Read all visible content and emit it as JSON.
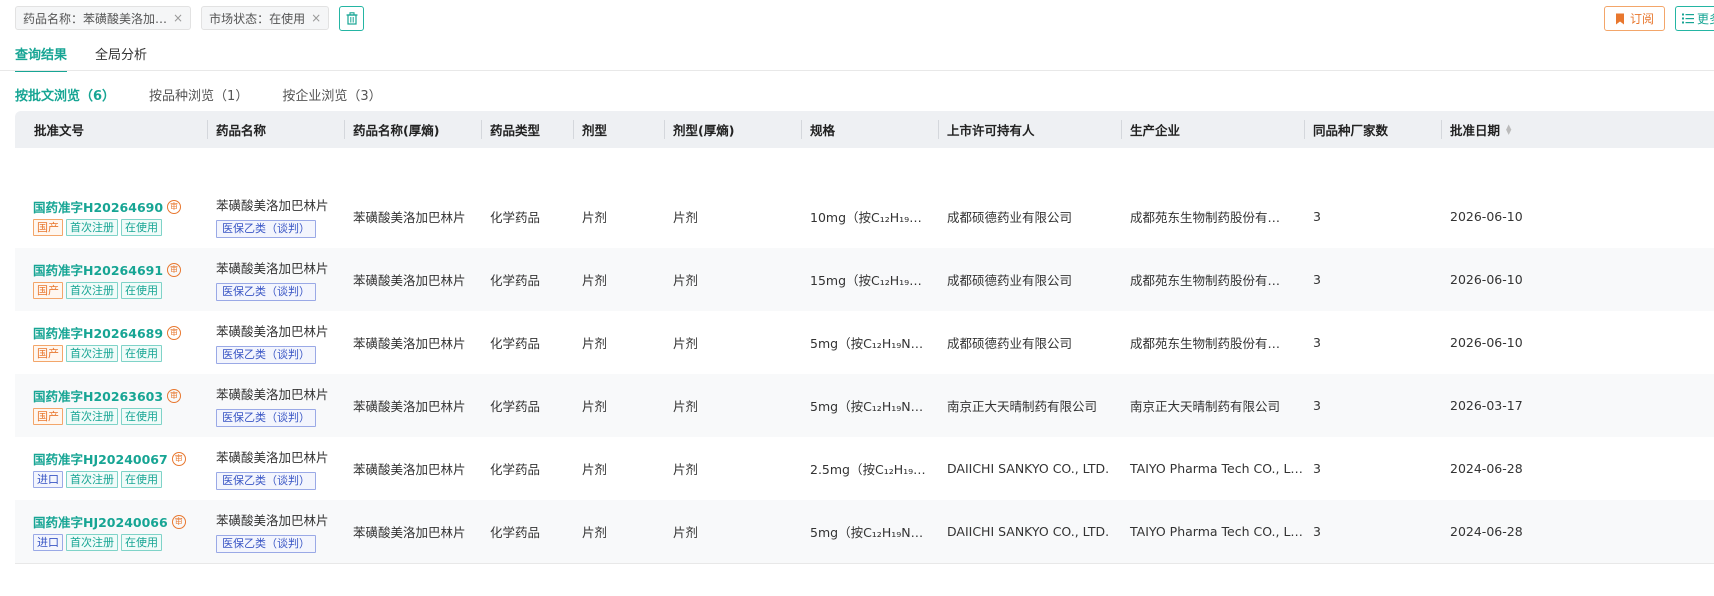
{
  "filters": {
    "chips": [
      {
        "label": "药品名称：苯磺酸美洛加…"
      },
      {
        "label": "市场状态：在使用"
      }
    ],
    "close_glyph": "×"
  },
  "actions": {
    "subscribe_label": "订阅",
    "more_label": "更多"
  },
  "tabs": [
    {
      "label": "查询结果",
      "active": true
    },
    {
      "label": "全局分析",
      "active": false
    }
  ],
  "subtabs": [
    {
      "label": "按批文浏览（6）",
      "active": true
    },
    {
      "label": "按品种浏览（1）",
      "active": false
    },
    {
      "label": "按企业浏览（3）",
      "active": false
    }
  ],
  "table": {
    "headers": [
      "批准文号",
      "药品名称",
      "药品名称(厚熵)",
      "药品类型",
      "剂型",
      "剂型(厚熵)",
      "规格",
      "上市许可持有人",
      "生产企业",
      "同品种厂家数",
      "批准日期"
    ],
    "review_badge": "审",
    "rows": [
      {
        "approval": "国药准字H20264690",
        "tags": [
          {
            "t": "国产",
            "c": "orange"
          },
          {
            "t": "首次注册",
            "c": "teal"
          },
          {
            "t": "在使用",
            "c": "teal"
          }
        ],
        "name": "苯磺酸美洛加巴林片",
        "insurance": "医保乙类（谈判）",
        "name_hs": "苯磺酸美洛加巴林片",
        "type": "化学药品",
        "form": "片剂",
        "form_hs": "片剂",
        "spec": "10mg（按C₁₂H₁₉…",
        "holder": "成都硕德药业有限公司",
        "maker": "成都苑东生物制药股份有…",
        "count": "3",
        "date": "2026-06-10"
      },
      {
        "approval": "国药准字H20264691",
        "tags": [
          {
            "t": "国产",
            "c": "orange"
          },
          {
            "t": "首次注册",
            "c": "teal"
          },
          {
            "t": "在使用",
            "c": "teal"
          }
        ],
        "name": "苯磺酸美洛加巴林片",
        "insurance": "医保乙类（谈判）",
        "name_hs": "苯磺酸美洛加巴林片",
        "type": "化学药品",
        "form": "片剂",
        "form_hs": "片剂",
        "spec": "15mg（按C₁₂H₁₉…",
        "holder": "成都硕德药业有限公司",
        "maker": "成都苑东生物制药股份有…",
        "count": "3",
        "date": "2026-06-10"
      },
      {
        "approval": "国药准字H20264689",
        "tags": [
          {
            "t": "国产",
            "c": "orange"
          },
          {
            "t": "首次注册",
            "c": "teal"
          },
          {
            "t": "在使用",
            "c": "teal"
          }
        ],
        "name": "苯磺酸美洛加巴林片",
        "insurance": "医保乙类（谈判）",
        "name_hs": "苯磺酸美洛加巴林片",
        "type": "化学药品",
        "form": "片剂",
        "form_hs": "片剂",
        "spec": "5mg（按C₁₂H₁₉N…",
        "holder": "成都硕德药业有限公司",
        "maker": "成都苑东生物制药股份有…",
        "count": "3",
        "date": "2026-06-10"
      },
      {
        "approval": "国药准字H20263603",
        "tags": [
          {
            "t": "国产",
            "c": "orange"
          },
          {
            "t": "首次注册",
            "c": "teal"
          },
          {
            "t": "在使用",
            "c": "teal"
          }
        ],
        "name": "苯磺酸美洛加巴林片",
        "insurance": "医保乙类（谈判）",
        "name_hs": "苯磺酸美洛加巴林片",
        "type": "化学药品",
        "form": "片剂",
        "form_hs": "片剂",
        "spec": "5mg（按C₁₂H₁₉N…",
        "holder": "南京正大天晴制药有限公司",
        "maker": "南京正大天晴制药有限公司",
        "count": "3",
        "date": "2026-03-17"
      },
      {
        "approval": "国药准字HJ20240067",
        "tags": [
          {
            "t": "进口",
            "c": "blue"
          },
          {
            "t": "首次注册",
            "c": "teal"
          },
          {
            "t": "在使用",
            "c": "teal"
          }
        ],
        "name": "苯磺酸美洛加巴林片",
        "insurance": "医保乙类（谈判）",
        "name_hs": "苯磺酸美洛加巴林片",
        "type": "化学药品",
        "form": "片剂",
        "form_hs": "片剂",
        "spec": "2.5mg（按C₁₂H₁₉…",
        "holder": "DAIICHI SANKYO CO., LTD.",
        "maker": "TAIYO Pharma Tech CO., L…",
        "count": "3",
        "date": "2024-06-28"
      },
      {
        "approval": "国药准字HJ20240066",
        "tags": [
          {
            "t": "进口",
            "c": "blue"
          },
          {
            "t": "首次注册",
            "c": "teal"
          },
          {
            "t": "在使用",
            "c": "teal"
          }
        ],
        "name": "苯磺酸美洛加巴林片",
        "insurance": "医保乙类（谈判）",
        "name_hs": "苯磺酸美洛加巴林片",
        "type": "化学药品",
        "form": "片剂",
        "form_hs": "片剂",
        "spec": "5mg（按C₁₂H₁₉N…",
        "holder": "DAIICHI SANKYO CO., LTD.",
        "maker": "TAIYO Pharma Tech CO., L…",
        "count": "3",
        "date": "2024-06-28"
      }
    ]
  },
  "colors": {
    "accent": "#17a594",
    "orange": "#e8772e",
    "blue": "#3a56c5"
  }
}
